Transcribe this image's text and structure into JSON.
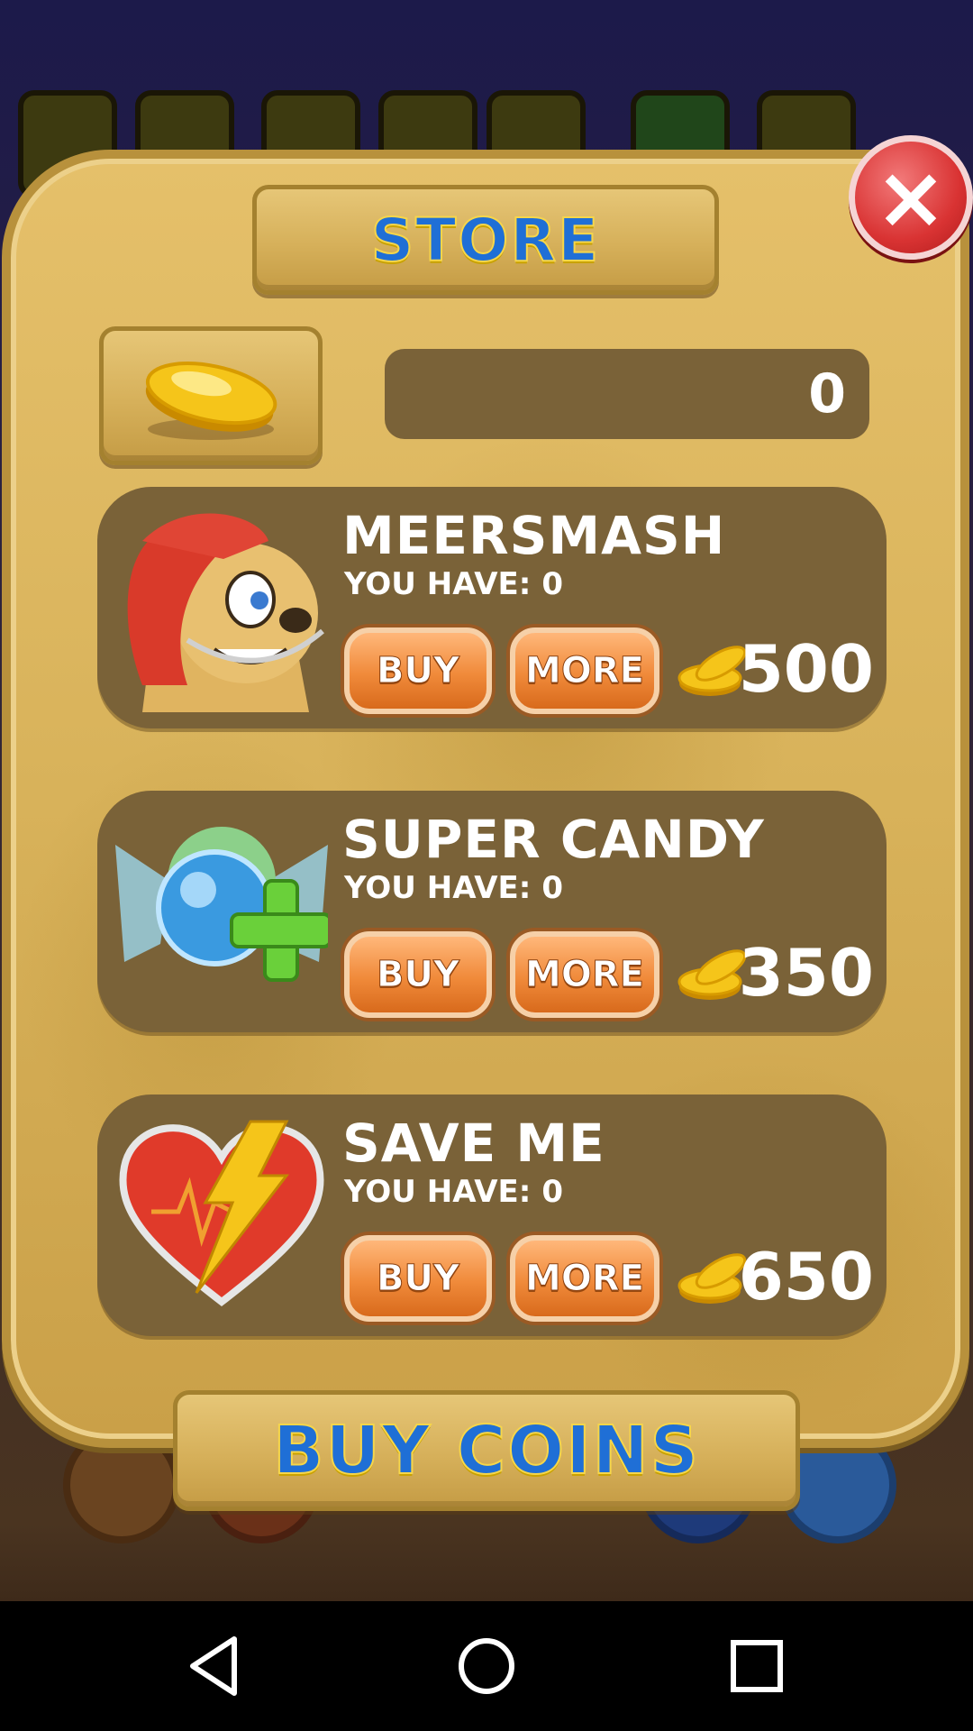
{
  "store": {
    "title": "STORE",
    "close_label": "×",
    "balance": "0",
    "buy_coins_label": "BUY COINS"
  },
  "items": [
    {
      "name": "MEERSMASH",
      "have_label": "YOU HAVE:",
      "have_count": "0",
      "buy_label": "BUY",
      "more_label": "MORE",
      "price": "500",
      "art_icon": "meerkat-helmet-icon"
    },
    {
      "name": "SUPER CANDY",
      "have_label": "YOU HAVE:",
      "have_count": "0",
      "buy_label": "BUY",
      "more_label": "MORE",
      "price": "350",
      "art_icon": "candy-plus-icon"
    },
    {
      "name": "SAVE ME",
      "have_label": "YOU HAVE:",
      "have_count": "0",
      "buy_label": "BUY",
      "more_label": "MORE",
      "price": "650",
      "art_icon": "heart-bolt-icon"
    }
  ],
  "colors": {
    "panel": "#d8b25a",
    "item_bg": "#7a6238",
    "button": "#f08a3a",
    "title_text": "#1f6fd6",
    "close": "#d93333"
  },
  "navbar": {
    "back_icon": "back-triangle-icon",
    "home_icon": "home-circle-icon",
    "recents_icon": "recents-square-icon"
  }
}
